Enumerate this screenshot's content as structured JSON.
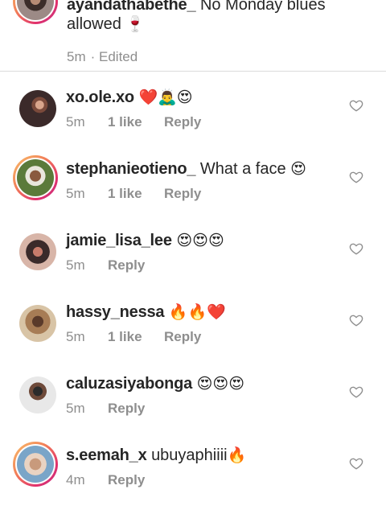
{
  "caption": {
    "username": "ayandathabethe_",
    "text": "No Monday blues allowed",
    "emoji": "🍷",
    "time": "5m",
    "edited": "· Edited"
  },
  "comments": [
    {
      "username": "xo.ole.xo",
      "text": "",
      "emoji": "❤️🙇‍♂️😍",
      "time": "5m",
      "likes": "1 like",
      "reply": "Reply",
      "story": false
    },
    {
      "username": "stephanieotieno_",
      "text": "What a face",
      "emoji": "😍",
      "time": "5m",
      "likes": "1 like",
      "reply": "Reply",
      "story": true
    },
    {
      "username": "jamie_lisa_lee",
      "text": "",
      "emoji": "😍😍😍",
      "time": "5m",
      "likes": "",
      "reply": "Reply",
      "story": false
    },
    {
      "username": "hassy_nessa",
      "text": "",
      "emoji": "🔥🔥❤️",
      "time": "5m",
      "likes": "1 like",
      "reply": "Reply",
      "story": false
    },
    {
      "username": "caluzasiyabonga",
      "text": "",
      "emoji": "😍😍😍",
      "time": "5m",
      "likes": "",
      "reply": "Reply",
      "story": false
    },
    {
      "username": "s.eemah_x",
      "text": "ubuyaphiiii",
      "emoji": "🔥",
      "time": "4m",
      "likes": "",
      "reply": "Reply",
      "story": true
    }
  ],
  "icons": {
    "like": "heart-outline-icon"
  },
  "colors": {
    "text": "#262626",
    "meta": "#8e8e8e",
    "divider": "#dbdbdb",
    "story_ring_start": "#f9c16a",
    "story_ring_end": "#c13584"
  }
}
